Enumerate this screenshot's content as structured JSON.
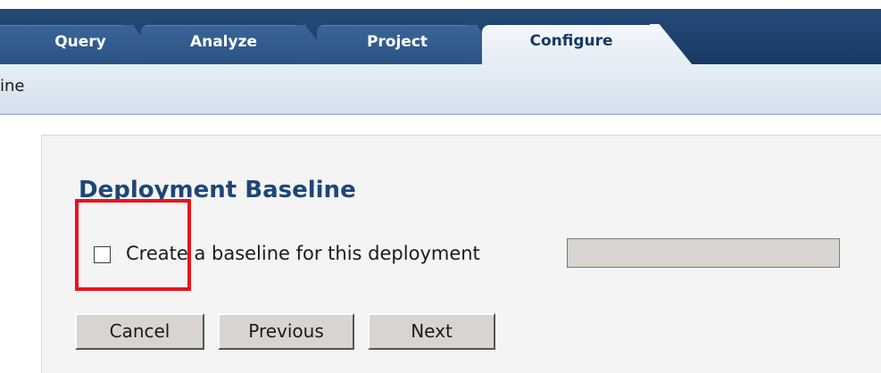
{
  "tabs": {
    "query": "Query",
    "analyze": "Analyze",
    "project": "Project",
    "configure": "Configure"
  },
  "breadcrumb": "ine",
  "section": {
    "title": "Deployment Baseline",
    "checkbox_label": "Create a baseline for this deployment",
    "checkbox_checked": false,
    "baseline_name_value": ""
  },
  "buttons": {
    "cancel": "Cancel",
    "previous": "Previous",
    "next": "Next"
  },
  "colors": {
    "header_bg": "#1d416d",
    "active_tab_text": "#173963",
    "title": "#1e4677",
    "highlight": "#e8141c"
  }
}
